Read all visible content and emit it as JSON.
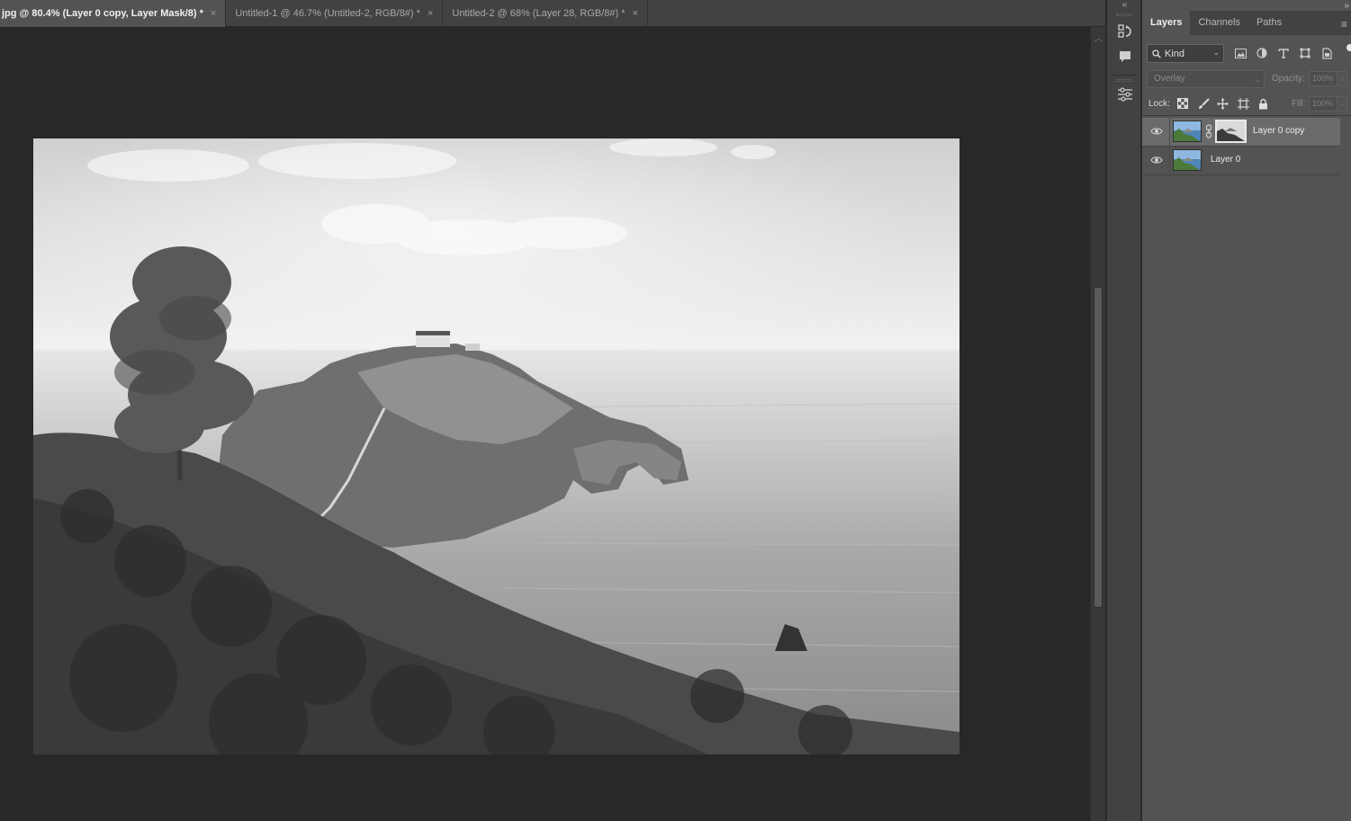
{
  "document_tabs": [
    {
      "label": "jpg @ 80.4% (Layer 0 copy, Layer Mask/8) *",
      "active": true
    },
    {
      "label": "Untitled-1 @ 46.7% (Untitled-2, RGB/8#) *",
      "active": false
    },
    {
      "label": "Untitled-2 @ 68% (Layer 28, RGB/8#) *",
      "active": false
    }
  ],
  "tab_close_glyph": "×",
  "collapse_glyph": "«",
  "toolstrip_icons": [
    "history-icon",
    "comment-icon",
    "adjustments-icon"
  ],
  "layers_panel": {
    "tabs": [
      "Layers",
      "Channels",
      "Paths"
    ],
    "menu_glyph": "≡",
    "filter": {
      "label": "Kind",
      "icons": [
        "image-filter-icon",
        "adjustment-filter-icon",
        "type-filter-icon",
        "shape-filter-icon",
        "smart-object-filter-icon"
      ]
    },
    "blend_mode": "Overlay",
    "opacity_label": "Opacity:",
    "opacity_value": "100%",
    "lock_label": "Lock:",
    "fill_label": "Fill:",
    "fill_value": "100%",
    "layers": [
      {
        "name": "Layer 0 copy",
        "selected": true,
        "has_mask": true
      },
      {
        "name": "Layer 0",
        "selected": false,
        "has_mask": false
      }
    ]
  },
  "colors": {
    "panel_bg": "#535353",
    "canvas_bg": "#282828",
    "selected_layer": "#6a6a6a"
  }
}
